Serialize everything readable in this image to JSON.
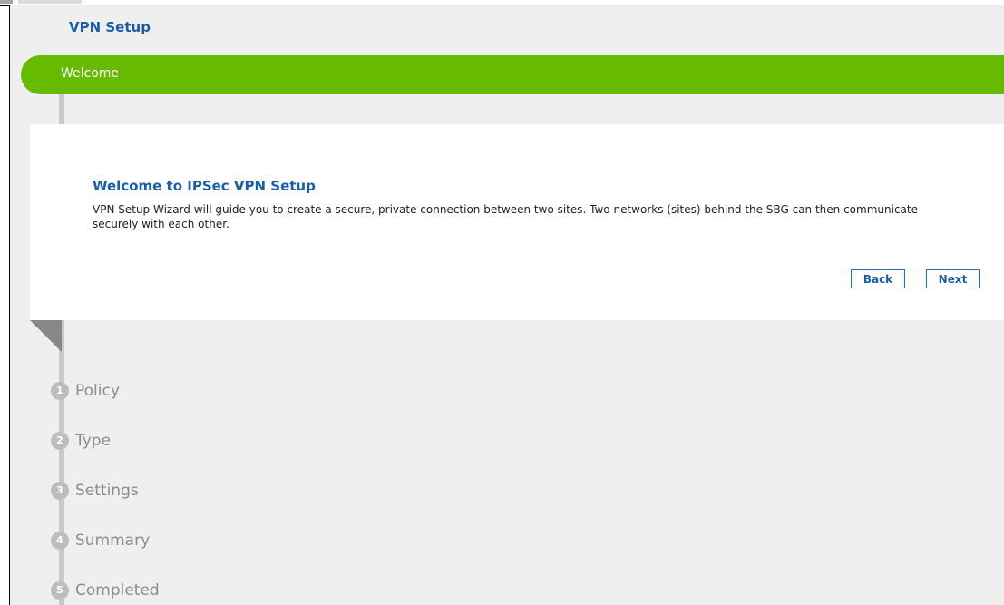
{
  "page": {
    "title": "VPN Setup"
  },
  "wizard": {
    "current_stage": "Welcome",
    "card": {
      "title": "Welcome to IPSec VPN Setup",
      "description": "VPN Setup Wizard will guide you to create a secure, private connection between two sites. Two networks (sites) behind the SBG can then communicate securely with each other.",
      "back_label": "Back",
      "next_label": "Next"
    },
    "steps": [
      {
        "number": "1",
        "label": "Policy"
      },
      {
        "number": "2",
        "label": "Type"
      },
      {
        "number": "3",
        "label": "Settings"
      },
      {
        "number": "4",
        "label": "Summary"
      },
      {
        "number": "5",
        "label": "Completed"
      }
    ]
  },
  "colors": {
    "accent_green": "#66bb00",
    "title_blue": "#1a5ea8",
    "step_gray": "#bdbdbd"
  }
}
